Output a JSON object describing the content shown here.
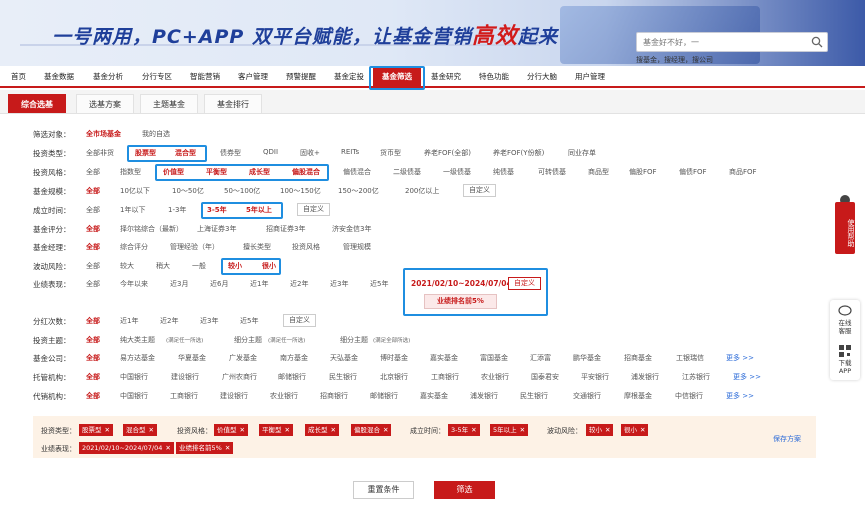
{
  "banner": {
    "slogan_a": "一号两用，PC+APP 双平台赋能，让基金营销",
    "slogan_hl": "高效",
    "slogan_b": "起来",
    "search_placeholder": "基金好不好，一",
    "search_placeholder_b": "就知道",
    "hotwords": "搜基金，搜经理，搜公司"
  },
  "nav": {
    "items": [
      "首页",
      "基金数据",
      "基金分析",
      "分行专区",
      "智能营销",
      "客户管理",
      "预警提醒",
      "基金定投",
      "基金筛选",
      "基金研究",
      "特色功能",
      "分行大脑",
      "用户管理"
    ],
    "active": "基金筛选"
  },
  "subtabs": [
    "综合选基",
    "选基方案",
    "主题基金",
    "基金排行"
  ],
  "filters": {
    "target": {
      "label": "筛选对象：",
      "options": [
        "全市场基金",
        "我的自选"
      ]
    },
    "type": {
      "label": "投资类型：",
      "options": [
        "全部非货",
        "股票型",
        "混合型",
        "债券型",
        "QDII",
        "固收+",
        "REITs",
        "货币型",
        "养老FOF(全部)",
        "养老FOF(Y份额)",
        "同业存单"
      ]
    },
    "style": {
      "label": "投资风格：",
      "options": [
        "全部",
        "指数型",
        "价值型",
        "平衡型",
        "成长型",
        "偏股混合",
        "偏债混合",
        "二级债基",
        "一级债基",
        "纯债基",
        "可转债基",
        "商品型",
        "偏股FOF",
        "偏债FOF",
        "商品FOF"
      ]
    },
    "scale": {
      "label": "基金规模：",
      "options": [
        "全部",
        "10亿以下",
        "10～50亿",
        "50～100亿",
        "100～150亿",
        "150～200亿",
        "200亿以上",
        "自定义"
      ]
    },
    "established": {
      "label": "成立时间：",
      "options": [
        "全部",
        "1年以下",
        "1-3年",
        "3-5年",
        "5年以上",
        "自定义"
      ]
    },
    "rating": {
      "label": "基金评分：",
      "options": [
        "全部",
        "择尔铭综合（最新）",
        "上海证券3年",
        "招商证券3年",
        "济安金信3年"
      ]
    },
    "manager": {
      "label": "基金经理：",
      "options": [
        "全部",
        "综合评分",
        "管理经验（年）",
        "擅长类型",
        "投资风格",
        "管理规模"
      ]
    },
    "volatility": {
      "label": "波动风险：",
      "options": [
        "全部",
        "较大",
        "稍大",
        "一般",
        "较小",
        "很小"
      ]
    },
    "performance": {
      "label": "业绩表现：",
      "options": [
        "全部",
        "今年以来",
        "近3月",
        "近6月",
        "近1年",
        "近2年",
        "近3年",
        "近5年"
      ],
      "custom_range": "2021/02/10~2024/07/04",
      "custom_btn": "自定义",
      "rank_btn": "业绩排名前5%"
    },
    "dividend": {
      "label": "分红次数：",
      "options": [
        "全部",
        "近1年",
        "近2年",
        "近3年",
        "近5年",
        "自定义"
      ]
    },
    "theme": {
      "label": "投资主题：",
      "options": [
        "全部",
        "纯大类主题",
        "(满足任一所选)",
        "细分主题",
        "(满足任一所选)",
        "细分主题",
        "(满足全部所选)"
      ]
    },
    "company": {
      "label": "基金公司：",
      "options": [
        "全部",
        "易方达基金",
        "华夏基金",
        "广发基金",
        "南方基金",
        "天弘基金",
        "博时基金",
        "嘉实基金",
        "富国基金",
        "汇添富",
        "鹏华基金",
        "招商基金",
        "工银瑞信"
      ],
      "more": "更多 >>"
    },
    "custodian": {
      "label": "托管机构：",
      "options": [
        "全部",
        "中国银行",
        "建设银行",
        "广州农商行",
        "邮储银行",
        "民生银行",
        "北京银行",
        "工商银行",
        "农业银行",
        "国泰君安",
        "平安银行",
        "浦发银行",
        "江苏银行"
      ],
      "more": "更多 >>"
    },
    "agency": {
      "label": "代销机构：",
      "options": [
        "全部",
        "中国银行",
        "工商银行",
        "建设银行",
        "农业银行",
        "招商银行",
        "邮储银行",
        "嘉实基金",
        "浦发银行",
        "民生银行",
        "交通银行",
        "摩根基金",
        "中信银行"
      ],
      "more": "更多 >>"
    }
  },
  "selected": {
    "type_label": "投资类型：",
    "type_tags": [
      "股票型",
      "混合型"
    ],
    "style_label": "投资风格：",
    "style_tags": [
      "价值型",
      "平衡型",
      "成长型",
      "偏股混合"
    ],
    "time_label": "成立时间：",
    "time_tags": [
      "3-5年",
      "5年以上"
    ],
    "vol_label": "波动风险：",
    "vol_tags": [
      "较小",
      "很小"
    ],
    "perf_label": "业绩表现：",
    "perf_tags": [
      "2021/02/10~2024/07/04",
      "业绩排名前5%"
    ],
    "save": "保存方案"
  },
  "buttons": {
    "reset": "重置条件",
    "submit": "筛选"
  },
  "side": {
    "help": "使用帮助",
    "service_a": "在线",
    "service_b": "客服",
    "download_a": "下载",
    "download_b": "APP"
  }
}
